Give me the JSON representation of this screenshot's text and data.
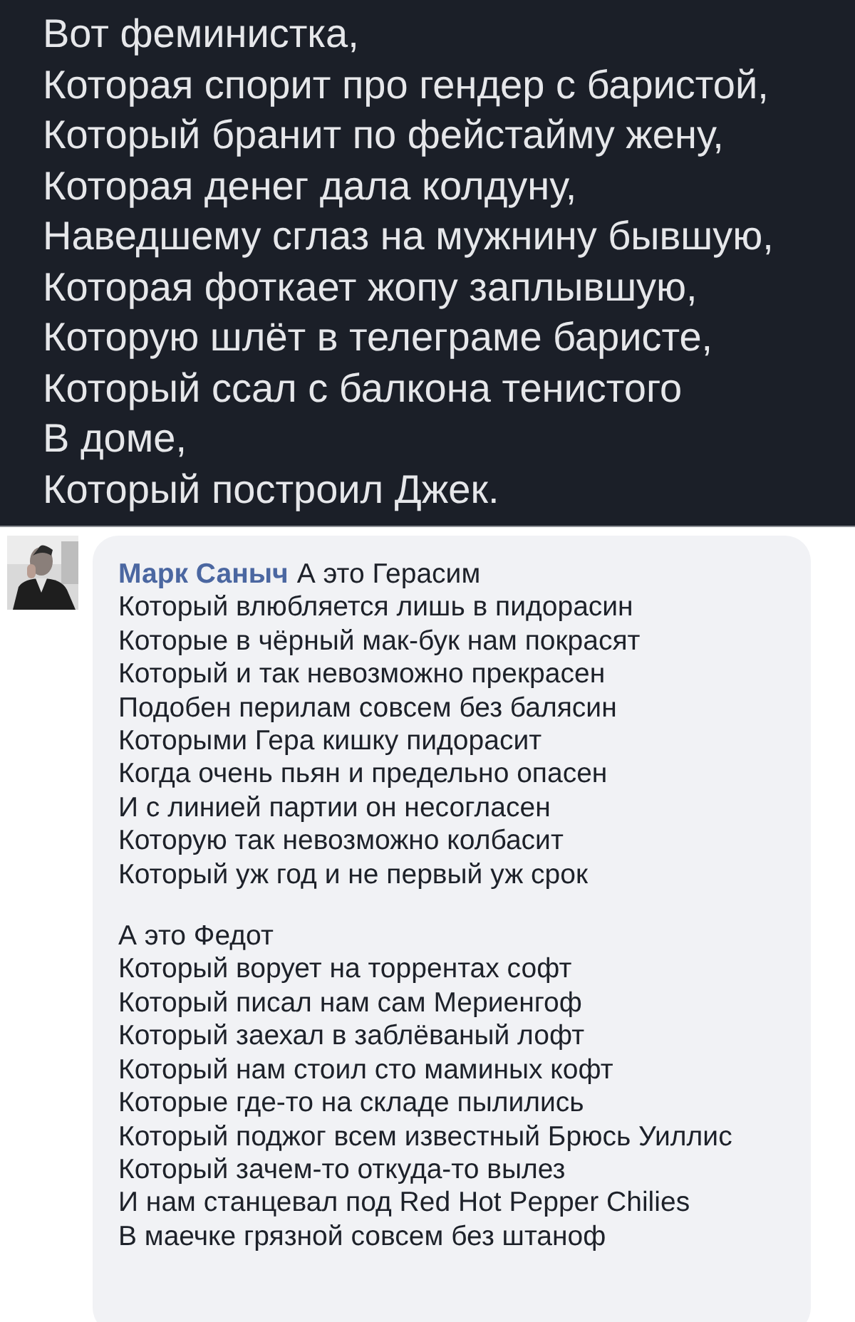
{
  "post": {
    "lines": [
      "Вот феминистка,",
      "Которая спорит про гендер с баристой,",
      "Который бранит по фейстайму жену,",
      "Которая денег дала колдуну,",
      "Наведшему сглаз на мужнину бывшую,",
      "Которая фоткает жопу заплывшую,",
      "Которую шлёт в телеграме баристе,",
      "Который ссал с балкона тенистого",
      "В доме,",
      "Который построил Джек."
    ]
  },
  "comment": {
    "author": "Марк Саныч",
    "paragraphs": [
      [
        "А это Герасим",
        "Который влюбляется лишь в пидорасин",
        "Которые в чёрный мак-бук нам покрасят",
        "Который и так невозможно прекрасен",
        "Подобен перилам совсем без балясин",
        "Которыми Гера кишку пидорасит",
        "Когда очень пьян и предельно опасен",
        "И с линией партии он несогласен",
        "Которую так невозможно колбасит",
        "Который уж год и не первый уж срок"
      ],
      [
        "А это Федот",
        "Который ворует на торрентах софт",
        "Который писал нам сам Мериенгоф",
        "Который заехал в заблёваный лофт",
        "Который нам стоил сто маминых кофт",
        "Которые где-то на складе пылились",
        "Который поджог всем известный Брюсь Уиллис",
        "Который зачем-то откуда-то вылез",
        "И нам станцевал под Red Hot Pepper Chilies",
        "В маечке грязной совсем без штаноф"
      ]
    ]
  }
}
